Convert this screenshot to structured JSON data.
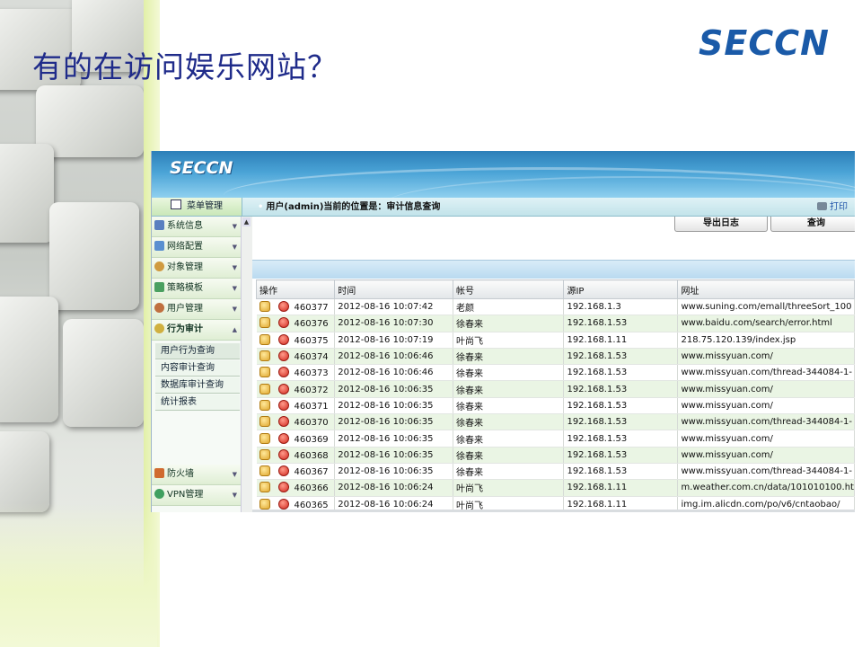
{
  "slide": {
    "title": "有的在访问娱乐网站？",
    "logo": "SECCN"
  },
  "app": {
    "banner_logo": "SECCN",
    "menu_tab": "菜单管理",
    "location": "用户(admin)当前的位置是：审计信息查询",
    "print_label": "打印"
  },
  "sidebar": {
    "items": [
      {
        "label": "系统信息",
        "icon": "system-info-icon"
      },
      {
        "label": "网络配置",
        "icon": "network-config-icon"
      },
      {
        "label": "对象管理",
        "icon": "object-manage-icon"
      },
      {
        "label": "策略模板",
        "icon": "policy-template-icon"
      },
      {
        "label": "用户管理",
        "icon": "user-manage-icon"
      },
      {
        "label": "行为审计",
        "icon": "behavior-audit-icon"
      }
    ],
    "subitems": [
      "用户行为查询",
      "内容审计查询",
      "数据库审计查询",
      "统计报表"
    ],
    "bottom_items": [
      {
        "label": "防火墙",
        "icon": "firewall-icon"
      },
      {
        "label": "VPN管理",
        "icon": "vpn-icon"
      }
    ]
  },
  "toolbar": {
    "export_label": "导出日志",
    "query_label": "查询"
  },
  "table": {
    "headers": [
      "操作",
      "时间",
      "帐号",
      "源IP",
      "网址"
    ],
    "rows": [
      {
        "id": "460377",
        "time": "2012-08-16 10:07:42",
        "account": "老颜",
        "ip": "192.168.1.3",
        "url": "www.suning.com/emall/threeSort_100"
      },
      {
        "id": "460376",
        "time": "2012-08-16 10:07:30",
        "account": "徐春来",
        "ip": "192.168.1.53",
        "url": "www.baidu.com/search/error.html"
      },
      {
        "id": "460375",
        "time": "2012-08-16 10:07:19",
        "account": "叶尚飞",
        "ip": "192.168.1.11",
        "url": "218.75.120.139/index.jsp"
      },
      {
        "id": "460374",
        "time": "2012-08-16 10:06:46",
        "account": "徐春来",
        "ip": "192.168.1.53",
        "url": "www.missyuan.com/"
      },
      {
        "id": "460373",
        "time": "2012-08-16 10:06:46",
        "account": "徐春来",
        "ip": "192.168.1.53",
        "url": "www.missyuan.com/thread-344084-1-"
      },
      {
        "id": "460372",
        "time": "2012-08-16 10:06:35",
        "account": "徐春来",
        "ip": "192.168.1.53",
        "url": "www.missyuan.com/"
      },
      {
        "id": "460371",
        "time": "2012-08-16 10:06:35",
        "account": "徐春来",
        "ip": "192.168.1.53",
        "url": "www.missyuan.com/"
      },
      {
        "id": "460370",
        "time": "2012-08-16 10:06:35",
        "account": "徐春来",
        "ip": "192.168.1.53",
        "url": "www.missyuan.com/thread-344084-1-"
      },
      {
        "id": "460369",
        "time": "2012-08-16 10:06:35",
        "account": "徐春来",
        "ip": "192.168.1.53",
        "url": "www.missyuan.com/"
      },
      {
        "id": "460368",
        "time": "2012-08-16 10:06:35",
        "account": "徐春来",
        "ip": "192.168.1.53",
        "url": "www.missyuan.com/"
      },
      {
        "id": "460367",
        "time": "2012-08-16 10:06:35",
        "account": "徐春来",
        "ip": "192.168.1.53",
        "url": "www.missyuan.com/thread-344084-1-"
      },
      {
        "id": "460366",
        "time": "2012-08-16 10:06:24",
        "account": "叶尚飞",
        "ip": "192.168.1.11",
        "url": "m.weather.com.cn/data/101010100.ht"
      },
      {
        "id": "460365",
        "time": "2012-08-16 10:06:24",
        "account": "叶尚飞",
        "ip": "192.168.1.11",
        "url": "img.im.alicdn.com/po/v6/cntaobao/"
      }
    ]
  },
  "colors": {
    "title": "#1f2b8a",
    "logo": "#1a5aa8",
    "banner": "#2c7fb8",
    "row_alt": "#eaf5e4"
  }
}
